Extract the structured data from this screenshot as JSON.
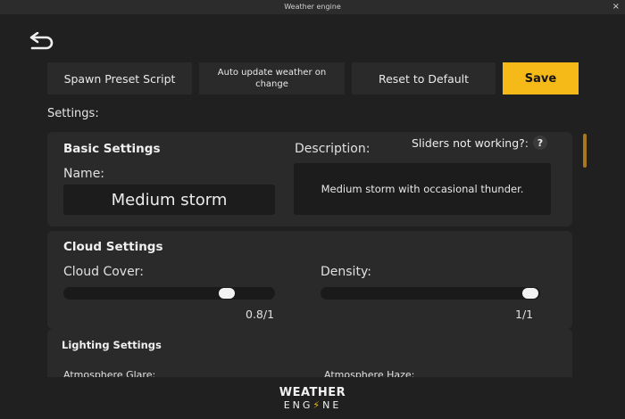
{
  "window": {
    "title": "Weather engine",
    "close_glyph": "×"
  },
  "toolbar": {
    "spawn_label": "Spawn Preset Script",
    "auto_update_label": "Auto update weather on change",
    "reset_label": "Reset to Default",
    "save_label": "Save"
  },
  "colors": {
    "accent": "#f5b918",
    "background": "#202020",
    "card": "#2a2a2a",
    "field": "#1c1c1c"
  },
  "settings_label": "Settings:",
  "basic": {
    "title": "Basic Settings",
    "name_label": "Name:",
    "name_value": "Medium storm",
    "description_label": "Description:",
    "description_value": "Medium storm with occasional thunder.",
    "help_text": "Sliders not working?:",
    "help_icon": "?"
  },
  "cloud": {
    "title": "Cloud Settings",
    "cover_label": "Cloud Cover:",
    "cover_value": "0.8/1",
    "cover_level": 0.8,
    "density_label": "Density:",
    "density_value": "1/1",
    "density_level": 1.0
  },
  "lighting": {
    "title": "Lighting Settings",
    "glare_label": "Atmosphere Glare:",
    "haze_label": "Atmosphere Haze:"
  },
  "footer": {
    "logo_line1": "WEATHER",
    "logo_line2_a": "ENG",
    "logo_line2_bolt": "⚡",
    "logo_line2_b": "NE"
  }
}
